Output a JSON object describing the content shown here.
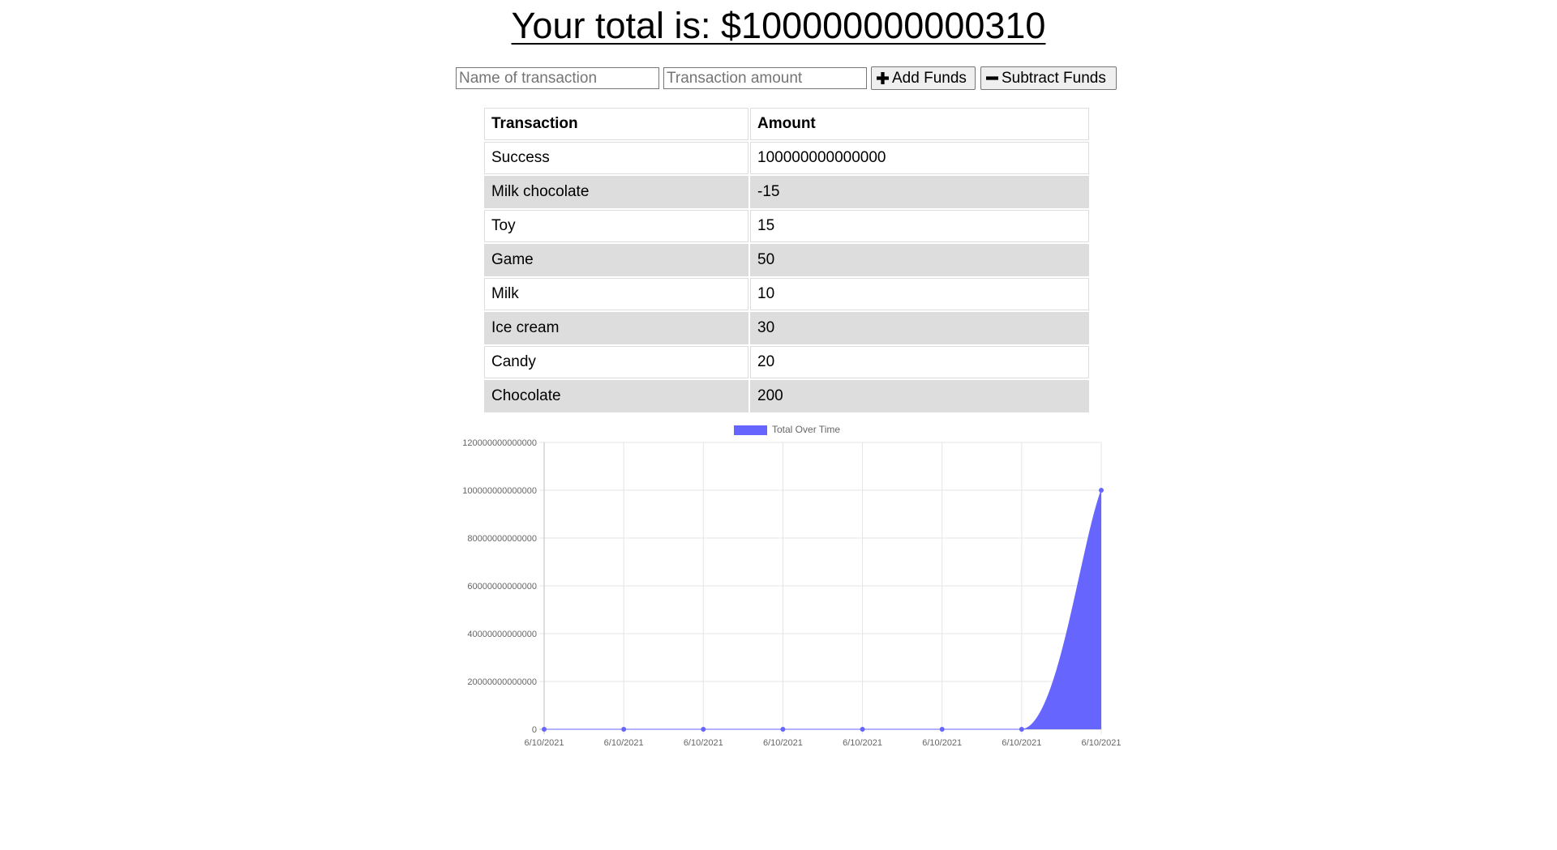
{
  "header": {
    "total_text": "Your total is: $100000000000310"
  },
  "form": {
    "name_placeholder": "Name of transaction",
    "amount_placeholder": "Transaction amount",
    "add_label": "Add Funds",
    "subtract_label": "Subtract Funds",
    "add_icon": "plus-icon",
    "subtract_icon": "minus-icon"
  },
  "table": {
    "headers": [
      "Transaction",
      "Amount"
    ],
    "rows": [
      {
        "name": "Success",
        "amount": "100000000000000"
      },
      {
        "name": "Milk chocolate",
        "amount": "-15"
      },
      {
        "name": "Toy",
        "amount": "15"
      },
      {
        "name": "Game",
        "amount": "50"
      },
      {
        "name": "Milk",
        "amount": "10"
      },
      {
        "name": "Ice cream",
        "amount": "30"
      },
      {
        "name": "Candy",
        "amount": "20"
      },
      {
        "name": "Chocolate",
        "amount": "200"
      }
    ]
  },
  "chart_data": {
    "type": "area",
    "legend": "Total Over Time",
    "legend_position": "top",
    "grid": true,
    "x": [
      "6/10/2021",
      "6/10/2021",
      "6/10/2021",
      "6/10/2021",
      "6/10/2021",
      "6/10/2021",
      "6/10/2021",
      "6/10/2021"
    ],
    "series": [
      {
        "name": "Total Over Time",
        "values": [
          200,
          220,
          250,
          260,
          310,
          325,
          310,
          100000000000310
        ]
      }
    ],
    "yticks": [
      "0",
      "20000000000000",
      "40000000000000",
      "60000000000000",
      "80000000000000",
      "100000000000000",
      "120000000000000"
    ],
    "ylim": [
      0,
      120000000000000
    ],
    "colors": {
      "fill": "#6666ff",
      "point": "#6666ff",
      "grid": "#e5e5e5",
      "tick_text": "#666666"
    }
  }
}
